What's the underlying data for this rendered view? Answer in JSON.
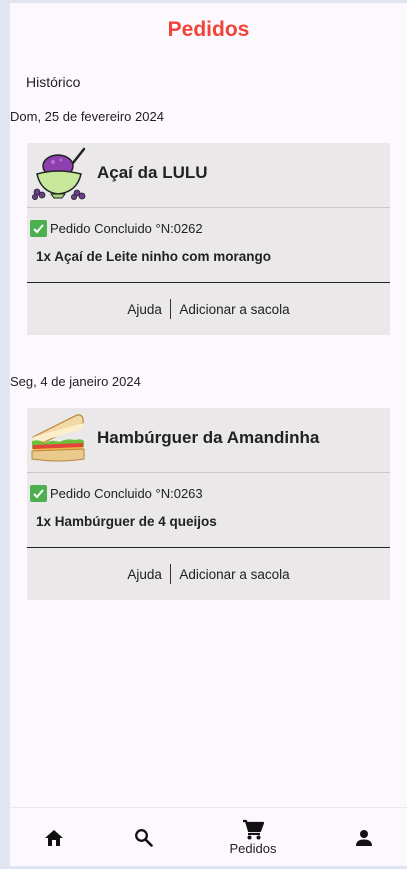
{
  "header": {
    "title": "Pedidos"
  },
  "section": {
    "label": "Histórico"
  },
  "orders": [
    {
      "date": "Dom, 25 de fevereiro 2024",
      "store_name": "Açaí da LULU",
      "store_icon": "acai-bowl-icon",
      "status": "Pedido Concluido °N:0262",
      "item": "1x Açaí de Leite ninho com morango",
      "help_label": "Ajuda",
      "add_label": "Adicionar a sacola"
    },
    {
      "date": "Seg, 4 de janeiro 2024",
      "store_name": "Hambúrguer da Amandinha",
      "store_icon": "sandwich-icon",
      "status": "Pedido Concluido °N:0263",
      "item": "1x Hambúrguer de 4 queijos",
      "help_label": "Ajuda",
      "add_label": "Adicionar a sacola"
    }
  ],
  "nav": {
    "items": [
      {
        "icon": "home-icon"
      },
      {
        "icon": "search-icon"
      },
      {
        "icon": "cart-icon",
        "label": "Pedidos",
        "active": true
      },
      {
        "icon": "person-icon"
      }
    ]
  },
  "colors": {
    "accent": "#f04438",
    "card": "#eae8e9",
    "check": "#4caf50",
    "background": "#fdf8fd"
  }
}
